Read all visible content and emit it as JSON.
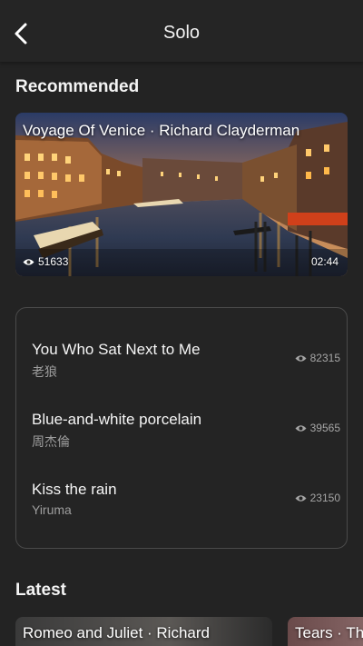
{
  "header": {
    "title": "Solo",
    "back_icon": "chevron-left-icon"
  },
  "sections": {
    "recommended": "Recommended",
    "latest": "Latest"
  },
  "featured": {
    "title": "Voyage Of Venice · Richard Clayderman",
    "views": "51633",
    "duration": "02:44",
    "image": "venice-grand-canal-night"
  },
  "songs": [
    {
      "title": "You Who Sat Next to Me",
      "artist": "老狼",
      "views": "82315"
    },
    {
      "title": "Blue-and-white porcelain",
      "artist": "周杰倫",
      "views": "39565"
    },
    {
      "title": "Kiss the rain",
      "artist": "Yiruma",
      "views": "23150"
    }
  ],
  "latest": [
    {
      "title": "Romeo and Juliet · Richard"
    },
    {
      "title": "Tears · Th"
    }
  ],
  "colors": {
    "background": "#232323",
    "card_border": "#4a4a4a",
    "muted_text": "#9e9e9e"
  }
}
